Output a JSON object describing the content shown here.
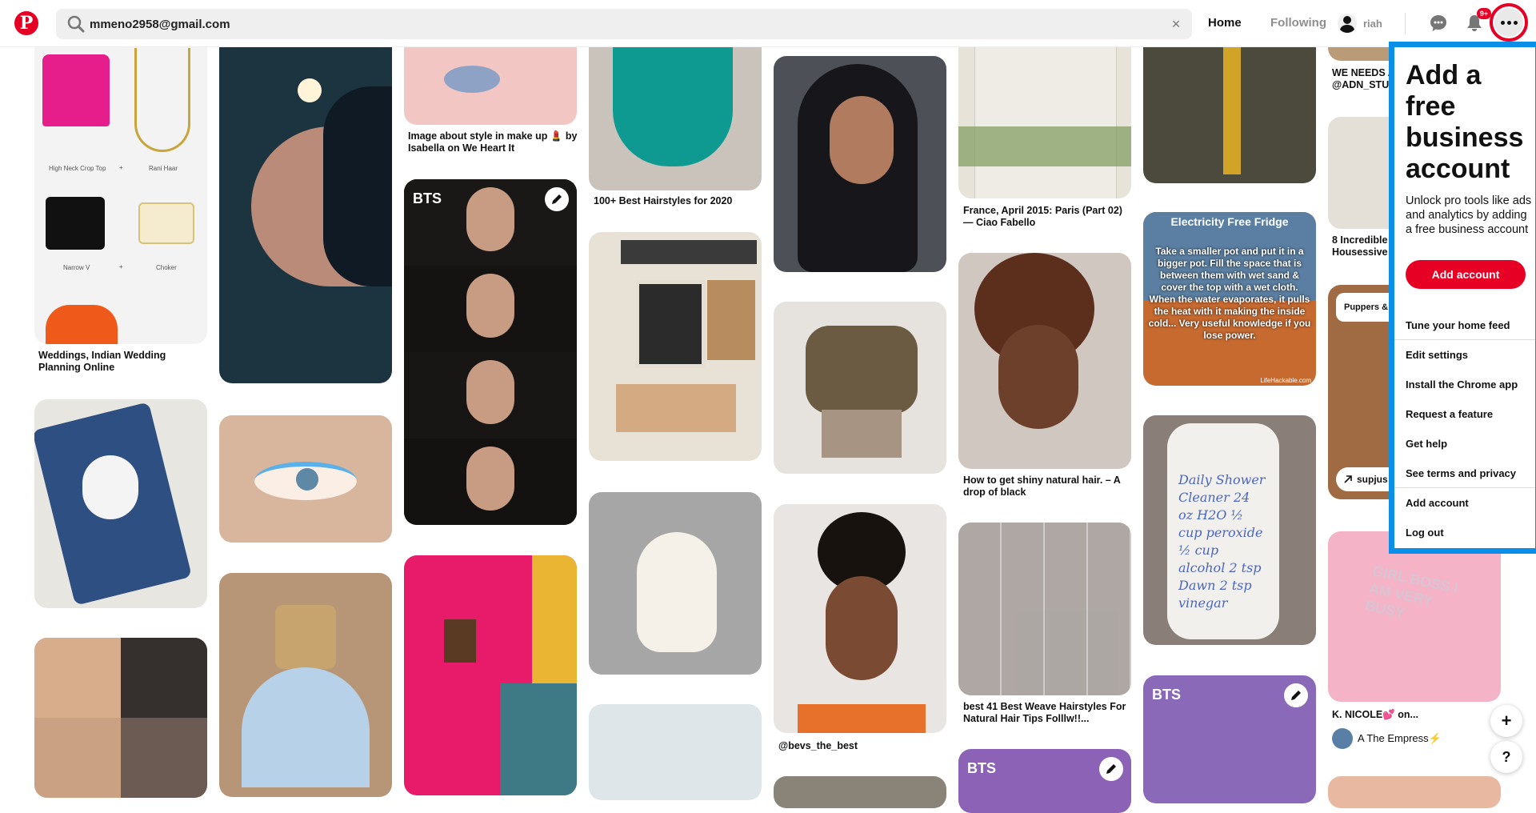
{
  "header": {
    "logo_letter": "P",
    "search_value": "mmeno2958@gmail.com",
    "search_clear": "×",
    "nav_home": "Home",
    "nav_following": "Following",
    "profile_name": "riah",
    "notification_badge": "9+"
  },
  "pins": {
    "wedding_labels": [
      "High Neck Crop Top",
      "+",
      "Rani Haar",
      "Narrow V",
      "+",
      "Choker"
    ],
    "wedding_caption": "Weddings, Indian Wedding Planning Online",
    "makeup_caption": "Image about style in make up 💄 by Isabella on We Heart It",
    "hairstyles_caption": "100+ Best Hairstyles for 2020",
    "paris_caption": "France, April 2015: Paris (Part 02) — Ciao Fabello",
    "natural_hair_caption": "How to get shiny natural hair. – A drop of black",
    "weave_caption": "best 41 Best Weave Hairstyles For Natural Hair Tips Folllw!!...",
    "bevs_caption": "@bevs_the_best",
    "bts_label": "BTS",
    "fridge_title": "Electricity Free Fridge",
    "fridge_text": "Take a smaller pot and put it in a bigger pot. Fill the space that is between them with wet sand & cover the top with a wet cloth. When the water evaporates, it pulls the heat with it making the inside cold... Very useful knowledge if you lose power.",
    "fridge_source": "LifeHackable.com",
    "bottle_text": "Daily Shower Cleaner 24 oz H2O ½ cup peroxide ½ cup alcohol 2 tsp Dawn 2 tsp vinegar",
    "we_needs_caption": "WE NEEDS A @ADN_STUD",
    "incredible_caption": "8 Incredible - Housessive",
    "puppers_label": "Puppers &",
    "supjus_label": "supjus",
    "nicole_caption": "K. NICOLE💕 on...",
    "empress_name": "A The Empress⚡",
    "mug_text": "GIRL BOSS I AM VERY BUSY"
  },
  "menu": {
    "title": "Add a free business account",
    "description": "Unlock pro tools like ads and analytics by adding a free business account",
    "add_button": "Add account",
    "items": [
      "Tune your home feed",
      "Edit settings",
      "Install the Chrome app",
      "Request a feature",
      "Get help",
      "See terms and privacy",
      "Add account",
      "Log out"
    ]
  },
  "fab": {
    "plus": "+",
    "help": "?"
  },
  "colors": {
    "brand": "#e60023",
    "highlight": "#0a8fe8"
  },
  "icons": [
    "search-icon",
    "close-icon",
    "message-icon",
    "bell-icon",
    "more-icon",
    "edit-icon",
    "arrow-icon"
  ]
}
